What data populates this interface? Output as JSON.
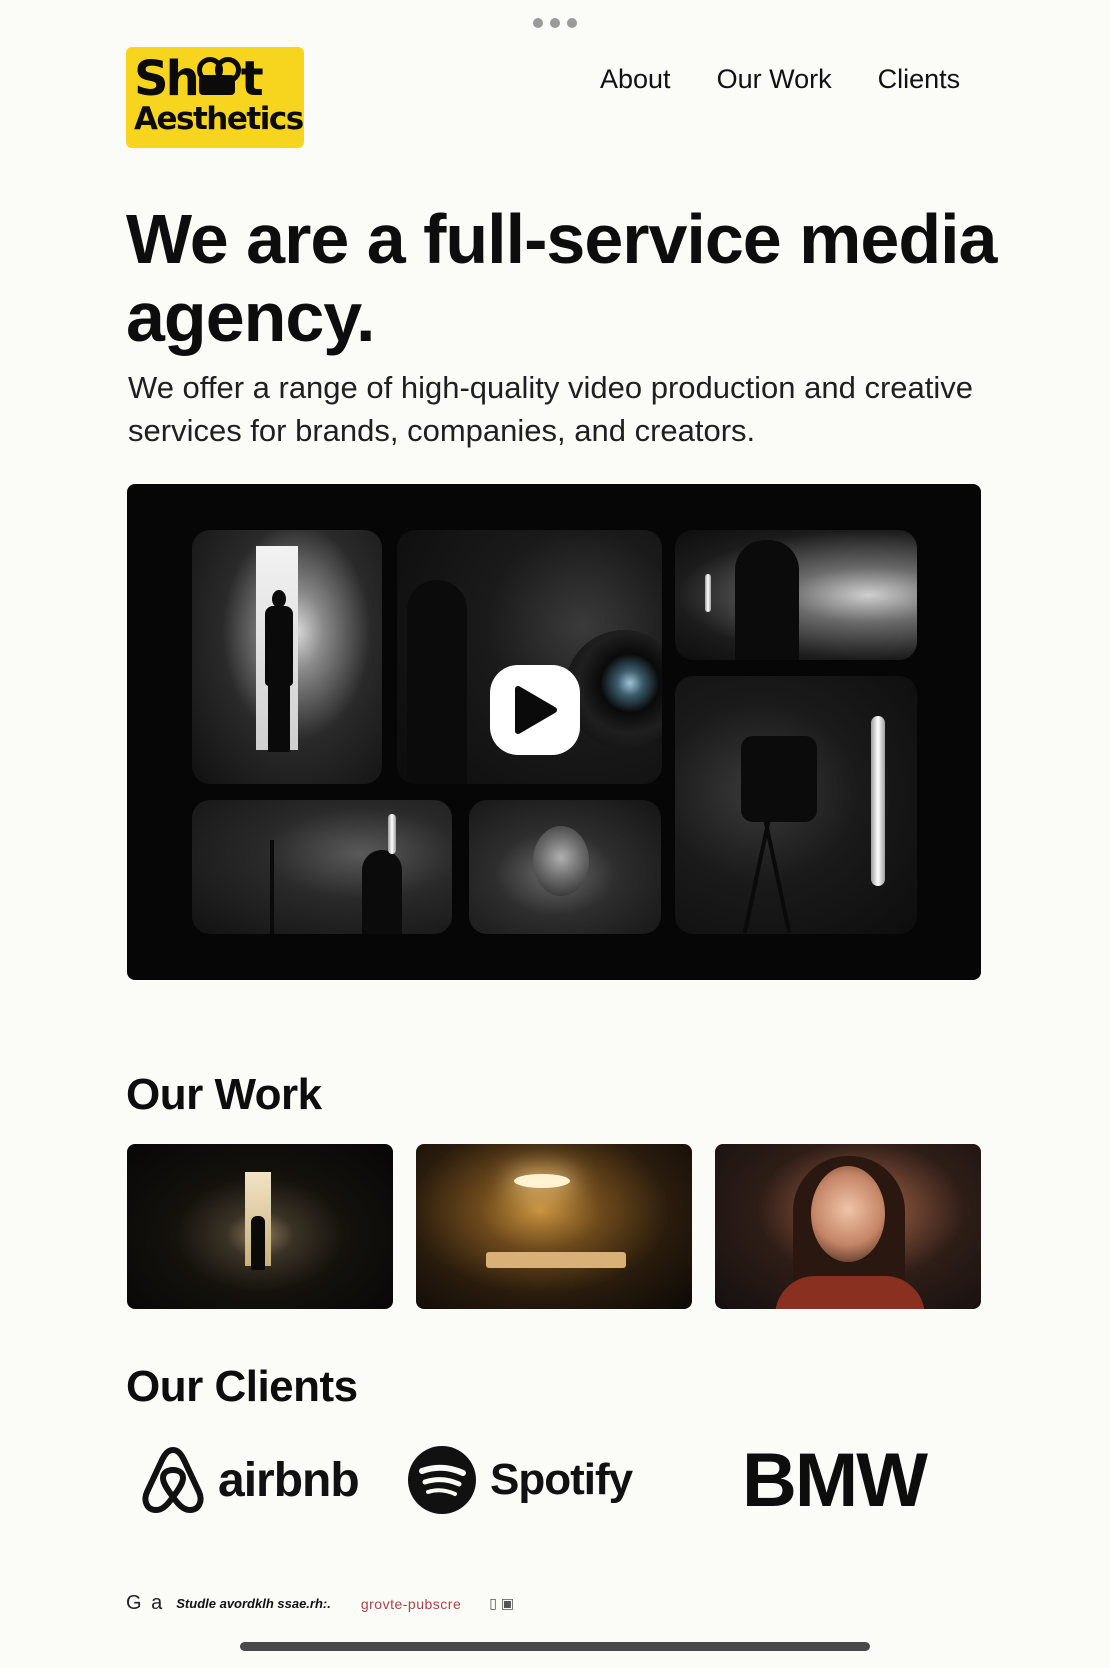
{
  "logo": {
    "line1": "Sh t",
    "line2": "Aesthetics",
    "brand_color": "#f7d51f",
    "icon": "camera-icon"
  },
  "nav": {
    "items": [
      "About",
      "Our Work",
      "Clients"
    ]
  },
  "hero": {
    "title": "We are a full-service media agency.",
    "subtitle": "We offer a range of high-quality video production and creative services for brands, companies, and creators."
  },
  "video": {
    "icon": "play-icon"
  },
  "work": {
    "title": "Our Work"
  },
  "clients": {
    "title": "Our Clients",
    "logos": [
      "airbnb",
      "Spotify",
      "BMW"
    ]
  },
  "footer": {
    "t1": "G a",
    "t2": "Studle avordklh ssae.rh:.",
    "t3": "grovte-pubscre",
    "t4": "▯ ▣"
  },
  "colors": {
    "background": "#fbfbf8",
    "text": "#111111",
    "accent": "#f7d51f"
  }
}
